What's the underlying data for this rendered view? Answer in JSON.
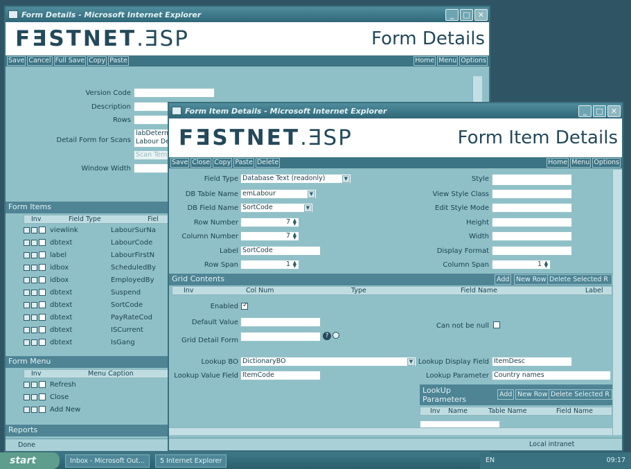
{
  "back_window": {
    "title": "Form Details - Microsoft Internet Explorer",
    "logo_main": "FƎSTNET",
    "logo_ext": ".ƎSP",
    "page_title": "Form Details",
    "menu_left": [
      "Save",
      "Cancel",
      "Full Save",
      "Copy",
      "Paste"
    ],
    "menu_right": [
      "Home",
      "Menu",
      "Options"
    ],
    "fields": {
      "version_code_label": "Version Code",
      "description_label": "Description",
      "rows_label": "Rows",
      "detail_form_label": "Detail Form for Scans",
      "detail_form_value1": "labDeterm",
      "detail_form_value2": "Labour De",
      "detail_form_value3": "Scan Tem",
      "window_width_label": "Window Width"
    },
    "form_items": {
      "title": "Form Items",
      "headers": [
        "Inv",
        "Field Type",
        "Fiel"
      ],
      "rows": [
        {
          "type": "viewlink",
          "field": "LabourSurNa"
        },
        {
          "type": "dbtext",
          "field": "LabourCode"
        },
        {
          "type": "label",
          "field": "LabourFirstN"
        },
        {
          "type": "idbox",
          "field": "ScheduledBy"
        },
        {
          "type": "idbox",
          "field": "EmployedBy"
        },
        {
          "type": "dbtext",
          "field": "Suspend"
        },
        {
          "type": "dbtext",
          "field": "SortCode"
        },
        {
          "type": "dbtext",
          "field": "PayRateCod"
        },
        {
          "type": "dbtext",
          "field": "ISCurrent"
        },
        {
          "type": "dbtext",
          "field": "IsGang"
        }
      ]
    },
    "form_menu": {
      "title": "Form Menu",
      "headers": [
        "Inv",
        "Menu Caption"
      ],
      "rows": [
        "Refresh",
        "Close",
        "Add New"
      ]
    },
    "reports_title": "Reports",
    "status": "Done"
  },
  "front_window": {
    "title": "Form Item Details - Microsoft Internet Explorer",
    "logo_main": "FƎSTNET",
    "logo_ext": ".ƎSP",
    "page_title": "Form Item Details",
    "menu_left": [
      "Save",
      "Close",
      "Copy",
      "Paste",
      "Delete"
    ],
    "menu_right": [
      "Home",
      "Menu",
      "Options"
    ],
    "fields": {
      "field_type_label": "Field Type",
      "field_type_value": "Database Text (readonly)",
      "db_table_label": "DB Table Name",
      "db_table_value": "emLabour",
      "db_field_label": "DB Field Name",
      "db_field_value": "SortCode",
      "row_number_label": "Row Number",
      "row_number_value": "7",
      "column_number_label": "Column Number",
      "column_number_value": "7",
      "label_label": "Label",
      "label_value": "SortCode",
      "row_span_label": "Row Span",
      "row_span_value": "1",
      "style_label": "Style",
      "view_style_label": "View Style Class",
      "edit_style_label": "Edit Style Mode",
      "height_label": "Height",
      "width_label": "Width",
      "display_format_label": "Display Format",
      "column_span_label": "Column Span",
      "column_span_value": "1"
    },
    "grid_contents": {
      "title": "Grid Contents",
      "buttons": [
        "Add",
        "New Row",
        "Delete Selected R"
      ],
      "headers": [
        "Inv",
        "Col Num",
        "Type",
        "Field Name",
        "Label"
      ]
    },
    "lower": {
      "enabled_label": "Enabled",
      "default_value_label": "Default Value",
      "can_not_be_null_label": "Can not be null",
      "grid_detail_form_label": "Grid Detail Form",
      "lookup_bo_label": "Lookup BO",
      "lookup_bo_value": "DictionaryBO",
      "lookup_display_label": "Lookup Display Field",
      "lookup_display_value": "ItemDesc",
      "lookup_value_label": "Lookup Value Field",
      "lookup_value_value": "ItemCode",
      "lookup_parameter_label": "Lookup Parameter",
      "lookup_parameter_value": "Country names",
      "lookup_params_title": "LookUp Parameters",
      "lookup_params_buttons": [
        "Add",
        "New Row",
        "Delete Selected R"
      ],
      "lookup_params_headers": [
        "Inv",
        "Name",
        "Table Name",
        "Field Name"
      ]
    },
    "status": "Local intranet"
  },
  "taskbar": {
    "start": "start",
    "items": [
      "Inbox - Microsoft Out...",
      "5 Internet Explorer"
    ],
    "lang": "EN",
    "clock": "09:17"
  }
}
